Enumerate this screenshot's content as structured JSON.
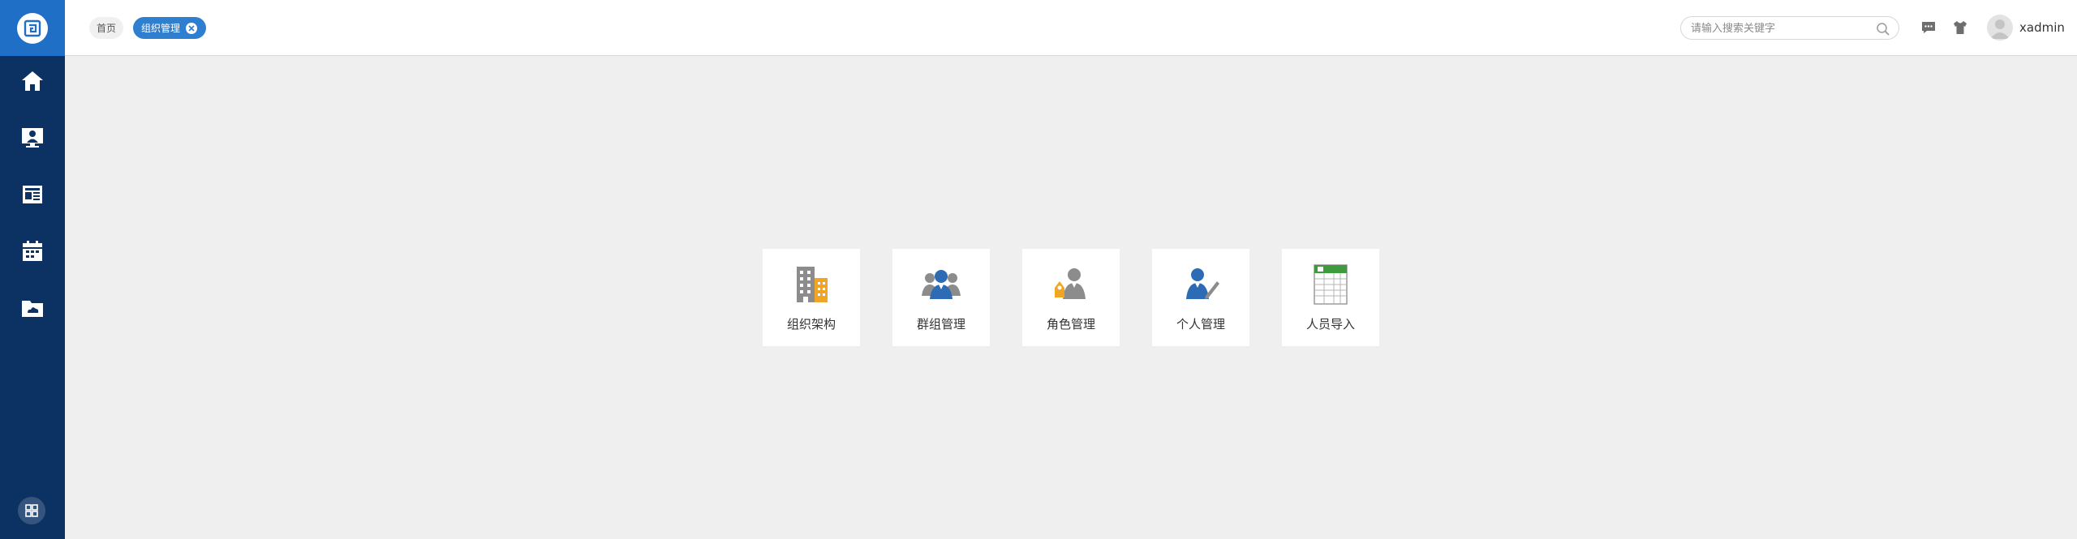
{
  "tabs": {
    "home_label": "首页",
    "active_label": "组织管理"
  },
  "search": {
    "placeholder": "请输入搜索关键字",
    "value": ""
  },
  "user": {
    "name": "xadmin"
  },
  "sidebar": {
    "items": [
      {
        "icon": "home-icon"
      },
      {
        "icon": "monitor-person-icon"
      },
      {
        "icon": "news-icon"
      },
      {
        "icon": "calendar-icon"
      },
      {
        "icon": "cloud-folder-icon"
      }
    ],
    "bottom_icon": "grid-apps-icon"
  },
  "tiles": [
    {
      "label": "组织架构",
      "icon": "building-icon"
    },
    {
      "label": "群组管理",
      "icon": "group-icon"
    },
    {
      "label": "角色管理",
      "icon": "role-icon"
    },
    {
      "label": "个人管理",
      "icon": "person-edit-icon"
    },
    {
      "label": "人员导入",
      "icon": "spreadsheet-import-icon"
    }
  ],
  "colors": {
    "sidebar": "#0c3263",
    "accent": "#2f7fd0",
    "background": "#efefef"
  }
}
